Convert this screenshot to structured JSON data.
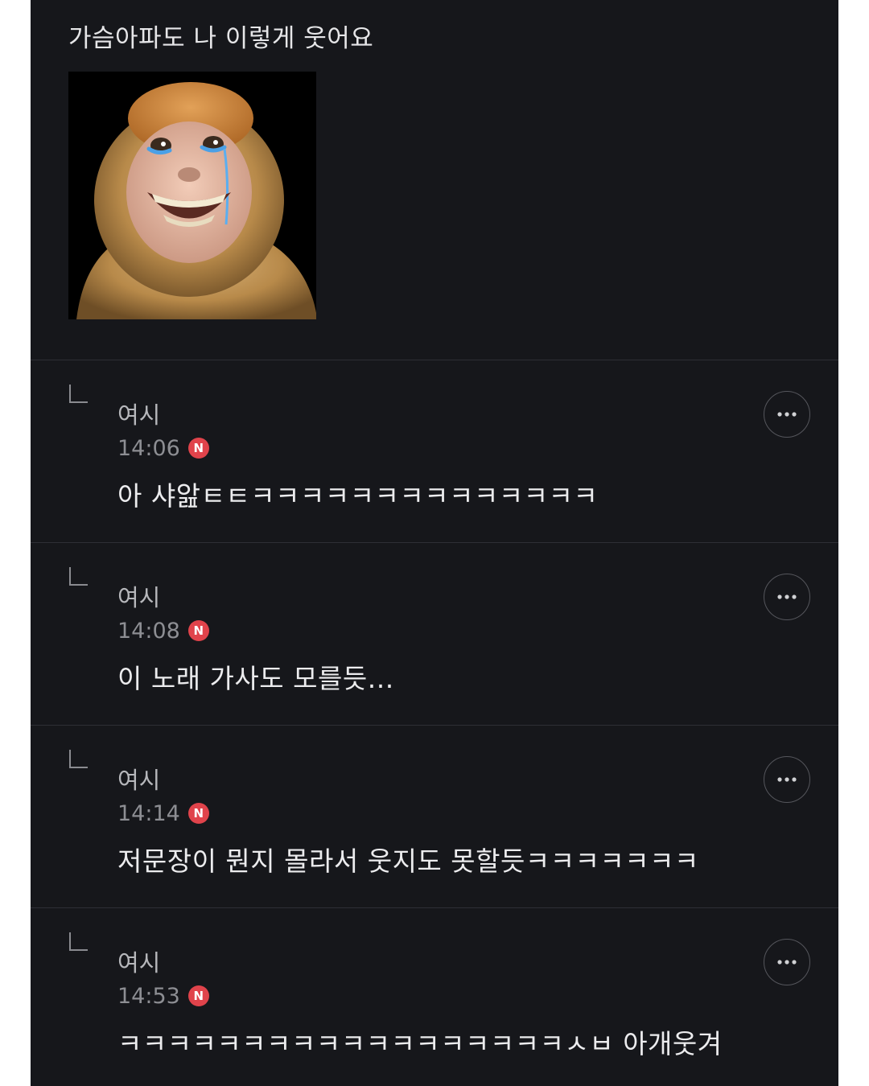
{
  "post": {
    "text": "가슴아파도 나 이렇게 웃어요",
    "image_alt": "crying-laughing-monkey-image"
  },
  "comments": [
    {
      "author": "여시",
      "time": "14:06",
      "badge": "N",
      "text": "아 샤앒ㅌㅌㅋㅋㅋㅋㅋㅋㅋㅋㅋㅋㅋㅋㅋㅋ"
    },
    {
      "author": "여시",
      "time": "14:08",
      "badge": "N",
      "text": "이 노래 가사도 모를듯..."
    },
    {
      "author": "여시",
      "time": "14:14",
      "badge": "N",
      "text": "저문장이 뭔지 몰라서 웃지도 못할듯ㅋㅋㅋㅋㅋㅋㅋ"
    },
    {
      "author": "여시",
      "time": "14:53",
      "badge": "N",
      "text": "ㅋㅋㅋㅋㅋㅋㅋㅋㅋㅋㅋㅋㅋㅋㅋㅋㅋㅋㅅㅂ 아개웃겨"
    }
  ],
  "icons": {
    "reply": "reply-arrow-icon",
    "more": "more-options-icon"
  },
  "colors": {
    "background": "#16171b",
    "new_badge": "#e0434b",
    "divider": "#2e2f35"
  }
}
